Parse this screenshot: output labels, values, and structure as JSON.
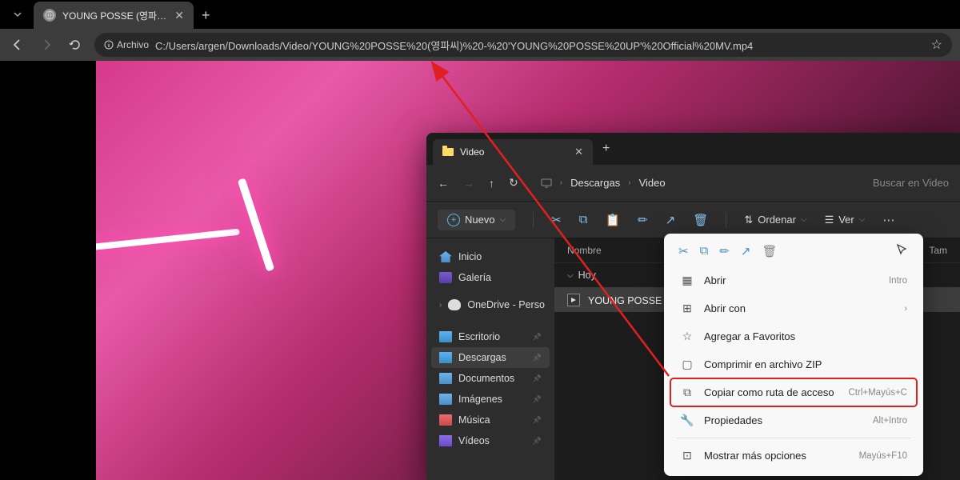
{
  "browser": {
    "tab_title": "YOUNG POSSE (영파씨) - 'YOU",
    "archivo_label": "Archivo",
    "url": "C:/Users/argen/Downloads/Video/YOUNG%20POSSE%20(영파씨)%20-%20'YOUNG%20POSSE%20UP'%20Official%20MV.mp4"
  },
  "explorer": {
    "tab_title": "Video",
    "breadcrumb": {
      "parent": "Descargas",
      "current": "Video"
    },
    "search_placeholder": "Buscar en Video",
    "new_button": "Nuevo",
    "sort_label": "Ordenar",
    "view_label": "Ver",
    "list_header_name": "Nombre",
    "list_header_size": "Tam",
    "group_today": "Hoy",
    "file_name": "YOUNG POSSE (영파씨)",
    "sidebar": {
      "home": "Inicio",
      "gallery": "Galería",
      "onedrive": "OneDrive - Perso",
      "desktop": "Escritorio",
      "downloads": "Descargas",
      "documents": "Documentos",
      "images": "Imágenes",
      "music": "Música",
      "videos": "Vídeos"
    }
  },
  "context_menu": {
    "open": {
      "label": "Abrir",
      "shortcut": "Intro"
    },
    "open_with": {
      "label": "Abrir con"
    },
    "add_favorites": {
      "label": "Agregar a Favoritos"
    },
    "compress_zip": {
      "label": "Comprimir en archivo ZIP"
    },
    "copy_path": {
      "label": "Copiar como ruta de acceso",
      "shortcut": "Ctrl+Mayús+C"
    },
    "properties": {
      "label": "Propiedades",
      "shortcut": "Alt+Intro"
    },
    "more_options": {
      "label": "Mostrar más opciones",
      "shortcut": "Mayús+F10"
    }
  }
}
